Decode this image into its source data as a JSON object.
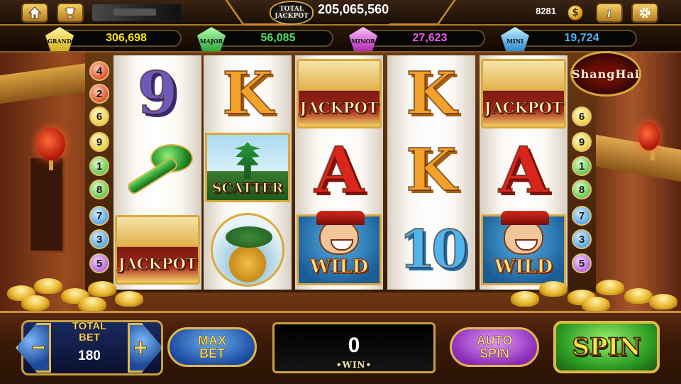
{
  "header": {
    "total_jackpot_label_line1": "TOTAL",
    "total_jackpot_label_line2": "JACKPOT",
    "total_jackpot_value": "205,065,560",
    "balance": "8281",
    "coin_symbol": "$",
    "icons": [
      "home-icon",
      "trophy-icon",
      "info-icon",
      "gear-icon"
    ]
  },
  "jackpots": [
    {
      "name": "GRAND",
      "value": "306,698",
      "color": "#ffe600"
    },
    {
      "name": "MAJOR",
      "value": "56,085",
      "color": "#4ee060"
    },
    {
      "name": "MINOR",
      "value": "27,623",
      "color": "#e85ae8"
    },
    {
      "name": "MINI",
      "value": "19,724",
      "color": "#4ab8f0"
    }
  ],
  "game": {
    "badge": "ShangHai",
    "paylines_left": [
      "4",
      "2",
      "6",
      "9",
      "1",
      "8",
      "7",
      "3",
      "5"
    ],
    "paylines_right": [
      "6",
      "9",
      "1",
      "8",
      "7",
      "3",
      "5"
    ],
    "reels": [
      [
        "9",
        "ruyi",
        "JACKPOT"
      ],
      [
        "K",
        "SCATTER",
        "bonsai"
      ],
      [
        "JACKPOT",
        "A",
        "WILD"
      ],
      [
        "K",
        "K",
        "10"
      ],
      [
        "JACKPOT",
        "A",
        "WILD"
      ]
    ]
  },
  "controls": {
    "total_bet_label_line1": "TOTAL",
    "total_bet_label_line2": "BET",
    "total_bet_value": "180",
    "decrease_label": "−",
    "increase_label": "+",
    "max_bet_line1": "MAX",
    "max_bet_line2": "BET",
    "win_value": "0",
    "win_label": "•WIN•",
    "auto_spin_line1": "AUTO",
    "auto_spin_line2": "SPIN",
    "spin_label": "SPIN"
  }
}
